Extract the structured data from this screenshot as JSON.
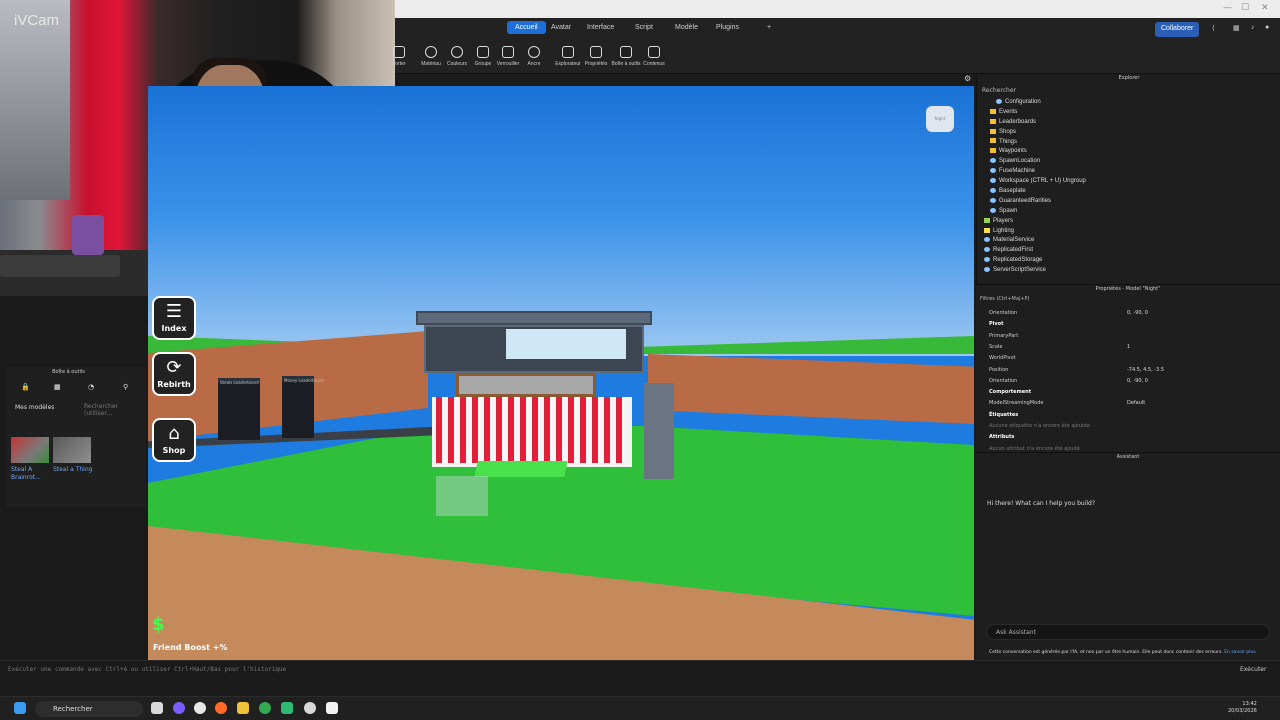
{
  "webcam": {
    "label": "iVCam"
  },
  "tabs": [
    "Accueil",
    "Avatar",
    "Interface",
    "Script",
    "Modèle",
    "Plugins",
    "+"
  ],
  "collaborate": "Collaborer",
  "ribbon_tools": [
    "porter",
    "Matériau",
    "Couleurs",
    "Groupe",
    "Verrouiller",
    "Ancre",
    "Explorateur",
    "Propriétés",
    "Boîte à outils",
    "Contenus"
  ],
  "toolbox": {
    "title": "Boîte à outils",
    "selector": "Mes modèles",
    "search_placeholder": "Rechercher (utiliser…",
    "models": [
      {
        "label": "Steal A Brainrot..."
      },
      {
        "label": "Steal a Thing"
      }
    ]
  },
  "viewport": {
    "side_buttons": [
      {
        "icon": "list-icon",
        "label": "Index"
      },
      {
        "icon": "refresh-icon",
        "label": "Rebirth"
      },
      {
        "icon": "shop-icon",
        "label": "Shop"
      }
    ],
    "boards": [
      "Steals Leaderboard",
      "Money Leaderboard"
    ],
    "money_symbol": "$",
    "friend_boost": "Friend Boost +%",
    "cloud_card": "Night"
  },
  "explorer": {
    "title": "Explorer",
    "search": "Rechercher",
    "items": [
      {
        "label": "Configuration",
        "indent": 2,
        "icon": "svc"
      },
      {
        "label": "Events",
        "indent": 1,
        "icon": "folder"
      },
      {
        "label": "Leaderboards",
        "indent": 1,
        "icon": "folder"
      },
      {
        "label": "Shops",
        "indent": 1,
        "icon": "folder"
      },
      {
        "label": "Things",
        "indent": 1,
        "icon": "folder"
      },
      {
        "label": "Waypoints",
        "indent": 1,
        "icon": "folder"
      },
      {
        "label": "SpawnLocation",
        "indent": 1,
        "icon": "svc"
      },
      {
        "label": "FuseMachine",
        "indent": 1,
        "icon": "svc"
      },
      {
        "label": "Workspace (CTRL + U) Ungroup",
        "indent": 1,
        "icon": "svc"
      },
      {
        "label": "Baseplate",
        "indent": 1,
        "icon": "svc"
      },
      {
        "label": "GuaranteedRarities",
        "indent": 1,
        "icon": "svc"
      },
      {
        "label": "Spawn",
        "indent": 1,
        "icon": "svc"
      },
      {
        "label": "Players",
        "indent": 0,
        "icon": "g"
      },
      {
        "label": "Lighting",
        "indent": 0,
        "icon": "y"
      },
      {
        "label": "MaterialService",
        "indent": 0,
        "icon": "svc"
      },
      {
        "label": "ReplicatedFirst",
        "indent": 0,
        "icon": "svc"
      },
      {
        "label": "ReplicatedStorage",
        "indent": 0,
        "icon": "svc"
      },
      {
        "label": "ServerScriptService",
        "indent": 0,
        "icon": "svc"
      }
    ]
  },
  "properties": {
    "title": "Propriétés - Model \"Night\"",
    "filter": "Filtres (Ctrl+Maj+P)",
    "rows": [
      {
        "k": "Orientation",
        "v": "0, -90, 0",
        "type": "prop"
      },
      {
        "k": "Pivot",
        "v": "",
        "type": "sec"
      },
      {
        "k": "PrimaryPart",
        "v": "",
        "type": "prop"
      },
      {
        "k": "Scale",
        "v": "1",
        "type": "prop"
      },
      {
        "k": "WorldPivot",
        "v": "",
        "type": "prop"
      },
      {
        "k": "Position",
        "v": "-74.5, 4.5, -3.5",
        "type": "prop"
      },
      {
        "k": "Orientation",
        "v": "0, -90, 0",
        "type": "prop"
      },
      {
        "k": "Comportement",
        "v": "",
        "type": "sec"
      },
      {
        "k": "ModelStreamingMode",
        "v": "Default",
        "type": "prop"
      },
      {
        "k": "Étiquettes",
        "v": "",
        "type": "sec"
      },
      {
        "k": "Aucune étiquette n'a encore été ajoutée",
        "v": "",
        "type": "hint"
      },
      {
        "k": "Attributs",
        "v": "",
        "type": "sec"
      },
      {
        "k": "Aucun attribut n'a encore été ajouté",
        "v": "",
        "type": "hint"
      }
    ]
  },
  "assistant": {
    "title": "Assistant",
    "greeting": "Hi there! What can I help you build?",
    "input_placeholder": "Ask Assistant",
    "note": "Cette conversation est générée par l'IA, et non par un être humain. Elle peut donc contenir des erreurs.",
    "note_link": "En savoir plus"
  },
  "command_bar": {
    "placeholder": "Exécuter une commande avec Ctrl+é ou utiliser Ctrl+Haut/Bas pour l'historique",
    "execute": "Exécuter"
  },
  "taskbar": {
    "search": "Rechercher",
    "time": "13:42",
    "date": "20/03/2026"
  }
}
